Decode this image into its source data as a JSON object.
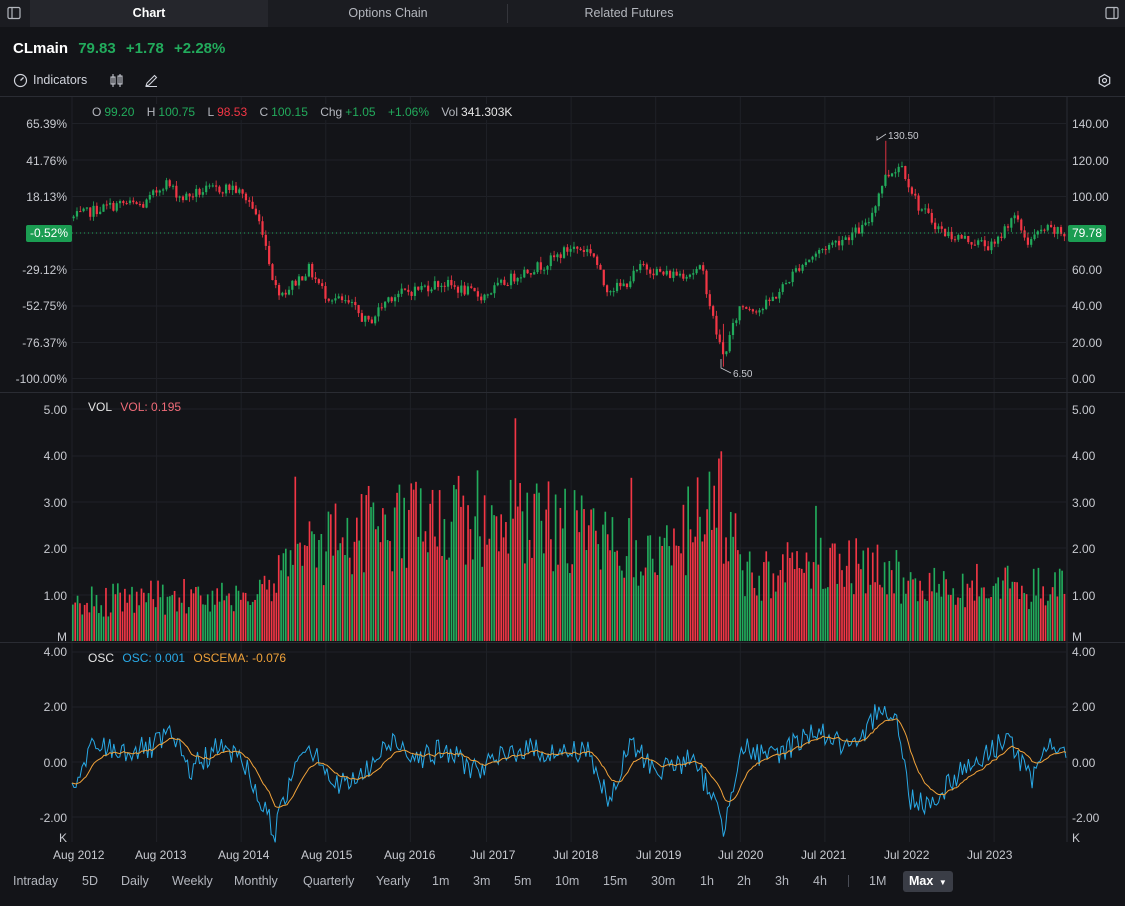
{
  "tabs": [
    {
      "label": "Chart"
    },
    {
      "label": "Options Chain"
    },
    {
      "label": "Related Futures"
    }
  ],
  "ticker": {
    "symbol": "CLmain",
    "price": "79.83",
    "change": "+1.78",
    "change_pct": "+2.28%"
  },
  "toolbar": {
    "indicators_label": "Indicators"
  },
  "ohlc": {
    "o_label": "O",
    "o": "99.20",
    "h_label": "H",
    "h": "100.75",
    "l_label": "L",
    "l": "98.53",
    "c_label": "C",
    "c": "100.15",
    "chg_label": "Chg",
    "chg": "+1.05",
    "chg_pct": "+1.06%",
    "vol_label": "Vol",
    "vol": "341.303K"
  },
  "vol_legend": {
    "name": "VOL",
    "value": "VOL: 0.195"
  },
  "osc_legend": {
    "name": "OSC",
    "osc": "OSC: 0.001",
    "oscema": "OSCEMA: -0.076"
  },
  "price_axis": {
    "left_ticks": [
      "65.39%",
      "41.76%",
      "18.13%",
      "-29.12%",
      "-52.75%",
      "-76.37%",
      "-100.00%"
    ],
    "right_ticks": [
      "140.00",
      "120.00",
      "100.00",
      "60.00",
      "40.00",
      "20.00",
      "0.00"
    ],
    "current_pct": "-0.52%",
    "current_price": "79.78",
    "high_label": "130.50",
    "low_label": "6.50"
  },
  "vol_axis": {
    "ticks": [
      "5.00",
      "4.00",
      "3.00",
      "2.00",
      "1.00"
    ],
    "unit": "M"
  },
  "osc_axis": {
    "ticks": [
      "4.00",
      "2.00",
      "0.00",
      "-2.00"
    ],
    "unit": "K"
  },
  "x_axis": {
    "labels": [
      "Aug 2012",
      "Aug 2013",
      "Aug 2014",
      "Aug 2015",
      "Aug 2016",
      "Jul 2017",
      "Jul 2018",
      "Jul 2019",
      "Jul 2020",
      "Jul 2021",
      "Jul 2022",
      "Jul 2023"
    ]
  },
  "periods": [
    {
      "label": "Intraday"
    },
    {
      "label": "5D"
    },
    {
      "label": "Daily"
    },
    {
      "label": "Weekly"
    },
    {
      "label": "Monthly"
    },
    {
      "label": "Quarterly"
    },
    {
      "label": "Yearly"
    },
    {
      "label": "1m"
    },
    {
      "label": "3m"
    },
    {
      "label": "5m"
    },
    {
      "label": "10m"
    },
    {
      "label": "15m"
    },
    {
      "label": "30m"
    },
    {
      "label": "1h"
    },
    {
      "label": "2h"
    },
    {
      "label": "3h"
    },
    {
      "label": "4h"
    },
    {
      "label": "1M"
    },
    {
      "label": "Max"
    }
  ],
  "colors": {
    "up": "#22ab5c",
    "down": "#f23645",
    "osc": "#29a9e6",
    "oscema": "#f0a23a",
    "bg": "#131418"
  },
  "chart_data": {
    "type": "candlestick",
    "symbol": "CLmain",
    "x_start": 2012.6,
    "x_end": 2024.35,
    "price": {
      "ylim": [
        0,
        140
      ],
      "keypoints": [
        [
          2012.6,
          88
        ],
        [
          2012.9,
          93
        ],
        [
          2013.2,
          96
        ],
        [
          2013.45,
          95
        ],
        [
          2013.7,
          108
        ],
        [
          2013.9,
          99
        ],
        [
          2014.15,
          103
        ],
        [
          2014.5,
          105
        ],
        [
          2014.7,
          97
        ],
        [
          2014.85,
          82
        ],
        [
          2015.0,
          50
        ],
        [
          2015.1,
          47
        ],
        [
          2015.4,
          60
        ],
        [
          2015.6,
          46
        ],
        [
          2015.9,
          40
        ],
        [
          2016.1,
          30
        ],
        [
          2016.35,
          45
        ],
        [
          2016.6,
          48
        ],
        [
          2016.9,
          52
        ],
        [
          2017.0,
          52
        ],
        [
          2017.45,
          45
        ],
        [
          2017.9,
          58
        ],
        [
          2018.2,
          63
        ],
        [
          2018.5,
          72
        ],
        [
          2018.75,
          70
        ],
        [
          2018.9,
          50
        ],
        [
          2019.1,
          50
        ],
        [
          2019.35,
          62
        ],
        [
          2019.6,
          57
        ],
        [
          2019.9,
          58
        ],
        [
          2020.05,
          60
        ],
        [
          2020.2,
          28
        ],
        [
          2020.3,
          12
        ],
        [
          2020.5,
          40
        ],
        [
          2020.75,
          38
        ],
        [
          2020.95,
          47
        ],
        [
          2021.2,
          62
        ],
        [
          2021.5,
          72
        ],
        [
          2021.85,
          80
        ],
        [
          2022.0,
          84
        ],
        [
          2022.2,
          110
        ],
        [
          2022.4,
          118
        ],
        [
          2022.6,
          95
        ],
        [
          2022.9,
          80
        ],
        [
          2023.2,
          76
        ],
        [
          2023.5,
          72
        ],
        [
          2023.72,
          90
        ],
        [
          2023.9,
          75
        ],
        [
          2024.1,
          82
        ],
        [
          2024.35,
          79
        ]
      ],
      "high": 130.5,
      "low": 6.5,
      "last": 79.78
    },
    "volume": {
      "ylim": [
        0,
        5
      ],
      "unit": "M",
      "keypoints": [
        [
          2012.6,
          0.9
        ],
        [
          2013.5,
          1.0
        ],
        [
          2014.6,
          1.1
        ],
        [
          2015.0,
          1.6
        ],
        [
          2015.5,
          2.1
        ],
        [
          2016.0,
          2.6
        ],
        [
          2016.8,
          2.8
        ],
        [
          2017.6,
          2.9
        ],
        [
          2018.4,
          2.6
        ],
        [
          2019.0,
          2.2
        ],
        [
          2019.6,
          2.0
        ],
        [
          2020.25,
          3.3
        ],
        [
          2020.6,
          1.5
        ],
        [
          2021.5,
          1.9
        ],
        [
          2022.2,
          1.7
        ],
        [
          2022.6,
          1.2
        ],
        [
          2023.5,
          1.3
        ],
        [
          2024.35,
          1.2
        ]
      ],
      "last": 0.195
    },
    "osc": {
      "ylim": [
        -3,
        4
      ],
      "unit": "K",
      "keypoints": [
        [
          2012.6,
          -1.2
        ],
        [
          2012.85,
          0.6
        ],
        [
          2013.2,
          0.4
        ],
        [
          2013.55,
          0.5
        ],
        [
          2013.75,
          1.0
        ],
        [
          2014.0,
          -0.3
        ],
        [
          2014.3,
          0.5
        ],
        [
          2014.6,
          0.2
        ],
        [
          2014.85,
          -1.6
        ],
        [
          2015.0,
          -2.5
        ],
        [
          2015.3,
          0.6
        ],
        [
          2015.5,
          0.4
        ],
        [
          2015.7,
          -0.9
        ],
        [
          2016.0,
          -0.6
        ],
        [
          2016.4,
          0.8
        ],
        [
          2016.7,
          0.2
        ],
        [
          2017.0,
          0.4
        ],
        [
          2017.4,
          -0.3
        ],
        [
          2017.9,
          0.5
        ],
        [
          2018.4,
          0.3
        ],
        [
          2018.7,
          0.5
        ],
        [
          2018.95,
          -1.6
        ],
        [
          2019.2,
          0.7
        ],
        [
          2019.5,
          -0.3
        ],
        [
          2019.9,
          0.1
        ],
        [
          2020.15,
          -1.0
        ],
        [
          2020.3,
          -2.5
        ],
        [
          2020.5,
          0.6
        ],
        [
          2020.8,
          0.1
        ],
        [
          2021.1,
          0.6
        ],
        [
          2021.4,
          1.2
        ],
        [
          2021.7,
          0.6
        ],
        [
          2021.9,
          0.4
        ],
        [
          2022.15,
          2.2
        ],
        [
          2022.35,
          1.5
        ],
        [
          2022.5,
          -1.3
        ],
        [
          2022.75,
          -1.5
        ],
        [
          2023.1,
          -0.3
        ],
        [
          2023.4,
          0.2
        ],
        [
          2023.65,
          1.0
        ],
        [
          2023.95,
          -0.8
        ],
        [
          2024.15,
          0.9
        ],
        [
          2024.35,
          0.0
        ]
      ],
      "last": 0.001,
      "ema_last": -0.076
    }
  }
}
